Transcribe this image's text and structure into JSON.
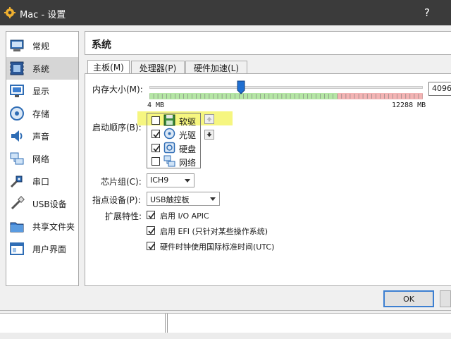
{
  "window": {
    "title": "Mac - 设置",
    "help_glyph": "?"
  },
  "sidebar": {
    "items": [
      {
        "label": "常规",
        "icon": "general-icon",
        "active": false
      },
      {
        "label": "系统",
        "icon": "system-icon",
        "active": true
      },
      {
        "label": "显示",
        "icon": "display-icon",
        "active": false
      },
      {
        "label": "存储",
        "icon": "storage-icon",
        "active": false
      },
      {
        "label": "声音",
        "icon": "audio-icon",
        "active": false
      },
      {
        "label": "网络",
        "icon": "network-icon",
        "active": false
      },
      {
        "label": "串口",
        "icon": "serial-port-icon",
        "active": false
      },
      {
        "label": "USB设备",
        "icon": "usb-icon",
        "active": false
      },
      {
        "label": "共享文件夹",
        "icon": "shared-folder-icon",
        "active": false
      },
      {
        "label": "用户界面",
        "icon": "user-interface-icon",
        "active": false
      }
    ]
  },
  "page": {
    "heading": "系统"
  },
  "tabs": [
    {
      "label": "主板(M)",
      "active": true
    },
    {
      "label": "处理器(P)",
      "active": false
    },
    {
      "label": "硬件加速(L)",
      "active": false
    }
  ],
  "motherboard": {
    "memory_label": "内存大小(M):",
    "memory_value": "4096",
    "memory_min": "4 MB",
    "memory_max": "12288 MB",
    "memory_slider_fraction": 0.333,
    "boot_order_label": "启动顺序(B):",
    "boot_items": [
      {
        "label": "软驱",
        "checked": false,
        "icon": "floppy-icon"
      },
      {
        "label": "光驱",
        "checked": true,
        "icon": "optical-drive-icon"
      },
      {
        "label": "硬盘",
        "checked": true,
        "icon": "hard-disk-icon"
      },
      {
        "label": "网络",
        "checked": false,
        "icon": "network-boot-icon"
      }
    ],
    "chipset_label": "芯片组(C):",
    "chipset_value": "ICH9",
    "pointing_label": "指点设备(P):",
    "pointing_value": "USB触控板",
    "extended_label": "扩展特性:",
    "features": [
      {
        "label": "启用 I/O APIC",
        "checked": true
      },
      {
        "label": "启用 EFI (只针对某些操作系统)",
        "checked": true
      },
      {
        "label": "硬件时钟使用国际标准时间(UTC)",
        "checked": true
      }
    ]
  },
  "buttons": {
    "ok": "OK"
  },
  "colors": {
    "titlebar": "#3b3b3b",
    "slider_green": "#b5e6a5",
    "slider_red": "#f3b4b4",
    "highlight": "#f5f56a",
    "accent": "#3c7fd1"
  }
}
